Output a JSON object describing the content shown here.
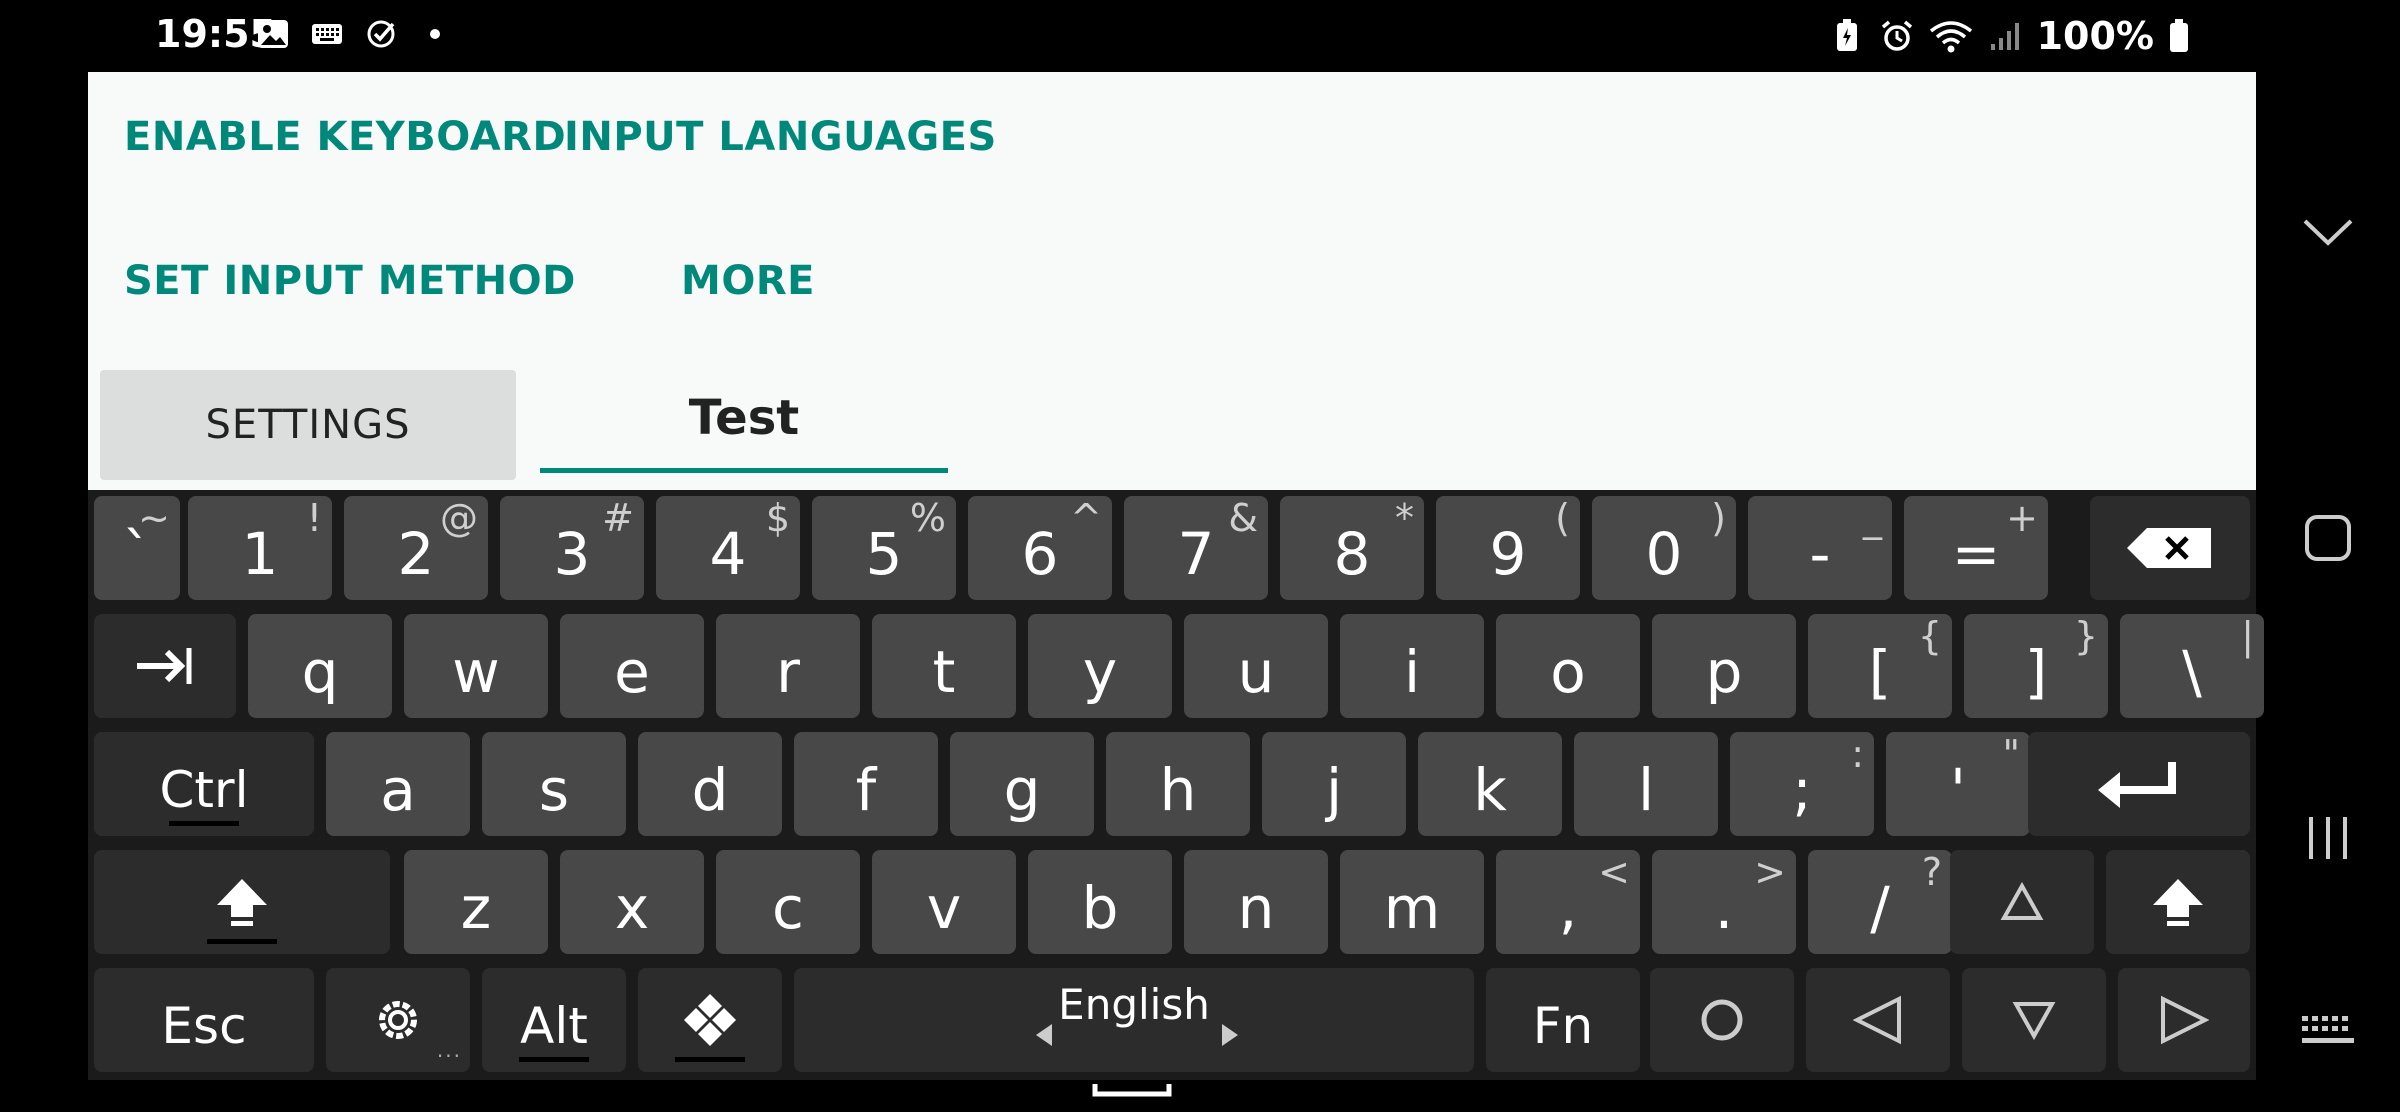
{
  "status": {
    "time": "19:55",
    "battery": "100%"
  },
  "app": {
    "enable_keyboard": "ENABLE KEYBOARD",
    "input_languages": "INPUT LANGUAGES",
    "set_input_method": "SET INPUT METHOD",
    "more": "MORE",
    "settings": "SETTINGS",
    "test_value": "Test"
  },
  "keyboard": {
    "row1": [
      {
        "main": "`",
        "alt": "~"
      },
      {
        "main": "1",
        "alt": "!"
      },
      {
        "main": "2",
        "alt": "@"
      },
      {
        "main": "3",
        "alt": "#"
      },
      {
        "main": "4",
        "alt": "$"
      },
      {
        "main": "5",
        "alt": "%"
      },
      {
        "main": "6",
        "alt": "^"
      },
      {
        "main": "7",
        "alt": "&"
      },
      {
        "main": "8",
        "alt": "*"
      },
      {
        "main": "9",
        "alt": "("
      },
      {
        "main": "0",
        "alt": ")"
      },
      {
        "main": "-",
        "alt": "_"
      },
      {
        "main": "=",
        "alt": "+"
      }
    ],
    "row2": [
      {
        "main": "q"
      },
      {
        "main": "w"
      },
      {
        "main": "e"
      },
      {
        "main": "r"
      },
      {
        "main": "t"
      },
      {
        "main": "y"
      },
      {
        "main": "u"
      },
      {
        "main": "i"
      },
      {
        "main": "o"
      },
      {
        "main": "p"
      },
      {
        "main": "[",
        "alt": "{"
      },
      {
        "main": "]",
        "alt": "}"
      },
      {
        "main": "\\",
        "alt": "|"
      }
    ],
    "row3": [
      {
        "main": "a"
      },
      {
        "main": "s"
      },
      {
        "main": "d"
      },
      {
        "main": "f"
      },
      {
        "main": "g"
      },
      {
        "main": "h"
      },
      {
        "main": "j"
      },
      {
        "main": "k"
      },
      {
        "main": "l"
      },
      {
        "main": ";",
        "alt": ":"
      },
      {
        "main": "'",
        "alt": "\""
      }
    ],
    "row4": [
      {
        "main": "z"
      },
      {
        "main": "x"
      },
      {
        "main": "c"
      },
      {
        "main": "v"
      },
      {
        "main": "b"
      },
      {
        "main": "n"
      },
      {
        "main": "m"
      },
      {
        "main": ",",
        "alt": "<"
      },
      {
        "main": ".",
        "alt": ">"
      },
      {
        "main": "/",
        "alt": "?"
      }
    ],
    "ctrl": "Ctrl",
    "esc": "Esc",
    "alt": "Alt",
    "language": "English",
    "fn": "Fn"
  }
}
